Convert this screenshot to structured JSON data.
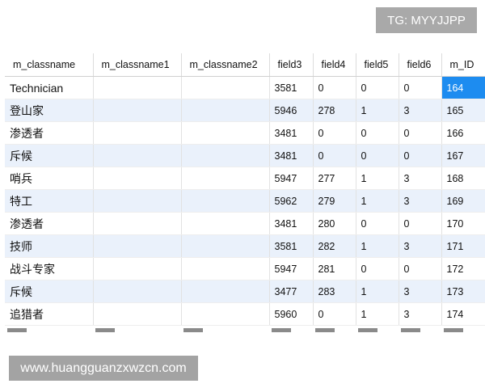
{
  "badge": "TG: MYYJJPP",
  "watermark": "www.huangguanzxwzcn.com",
  "grid": {
    "columns": [
      "m_classname",
      "m_classname1",
      "m_classname2",
      "field3",
      "field4",
      "field5",
      "field6",
      "m_ID"
    ],
    "rows": [
      [
        "Technician",
        "",
        "",
        "3581",
        "0",
        "0",
        "0",
        "164"
      ],
      [
        "登山家",
        "",
        "",
        "5946",
        "278",
        "1",
        "3",
        "165"
      ],
      [
        "渗透者",
        "",
        "",
        "3481",
        "0",
        "0",
        "0",
        "166"
      ],
      [
        "斥候",
        "",
        "",
        "3481",
        "0",
        "0",
        "0",
        "167"
      ],
      [
        "哨兵",
        "",
        "",
        "5947",
        "277",
        "1",
        "3",
        "168"
      ],
      [
        "特工",
        "",
        "",
        "5962",
        "279",
        "1",
        "3",
        "169"
      ],
      [
        "渗透者",
        "",
        "",
        "3481",
        "280",
        "0",
        "0",
        "170"
      ],
      [
        "技师",
        "",
        "",
        "3581",
        "282",
        "1",
        "3",
        "171"
      ],
      [
        "战斗专家",
        "",
        "",
        "5947",
        "281",
        "0",
        "0",
        "172"
      ],
      [
        "斥候",
        "",
        "",
        "3477",
        "283",
        "1",
        "3",
        "173"
      ],
      [
        "追猎者",
        "",
        "",
        "5960",
        "0",
        "1",
        "3",
        "174"
      ]
    ],
    "selected_cell": "164"
  },
  "colors": {
    "row_alt": "#eaf1fb",
    "selection": "#1d8cf0",
    "badge_bg": "#a9a9a9",
    "watermark_bg": "#a3a3a3"
  }
}
